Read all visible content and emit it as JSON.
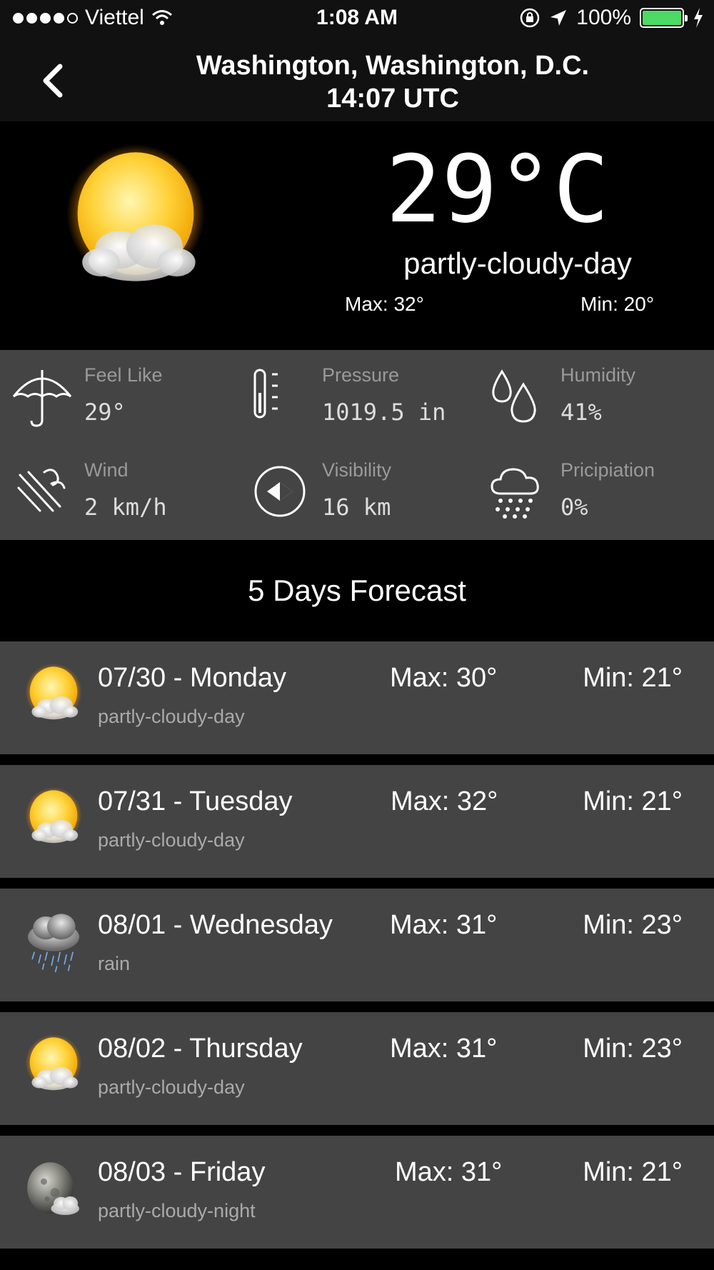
{
  "status_bar": {
    "carrier": "Viettel",
    "time": "1:08 AM",
    "battery": "100%",
    "battery_level": 1.0
  },
  "header": {
    "location": "Washington, Washington D.C.",
    "location_display": "Washington, Washington, D.C.",
    "time": "14:07 UTC"
  },
  "current": {
    "temperature": "29°C",
    "condition": "partly-cloudy-day",
    "max": "Max:  32°",
    "min": "Min:   20°",
    "icon": "partly-cloudy-day-icon"
  },
  "details": [
    {
      "label": "Feel Like",
      "value": "29°",
      "icon": "umbrella-icon"
    },
    {
      "label": "Pressure",
      "value": "1019.5 in",
      "icon": "thermometer-icon"
    },
    {
      "label": "Humidity",
      "value": "41%",
      "icon": "droplets-icon"
    },
    {
      "label": "Wind",
      "value": "2 km/h",
      "icon": "wind-icon"
    },
    {
      "label": "Visibility",
      "value": "16 km",
      "icon": "compass-icon"
    },
    {
      "label": "Pricipiation",
      "value": "0%",
      "icon": "cloud-rain-icon"
    }
  ],
  "forecast_title": "5 Days Forecast",
  "forecast": [
    {
      "date": "07/30 - Monday",
      "condition": "partly-cloudy-day",
      "max": "Max: 30°",
      "min": "Min: 21°",
      "icon": "partly-cloudy-day-icon"
    },
    {
      "date": "07/31 - Tuesday",
      "condition": "partly-cloudy-day",
      "max": "Max: 32°",
      "min": "Min: 21°",
      "icon": "partly-cloudy-day-icon"
    },
    {
      "date": "08/01 - Wednesday",
      "condition": "rain",
      "max": "Max: 31°",
      "min": "Min: 23°",
      "icon": "rain-icon"
    },
    {
      "date": "08/02 - Thursday",
      "condition": "partly-cloudy-day",
      "max": "Max: 31°",
      "min": "Min: 23°",
      "icon": "partly-cloudy-day-icon"
    },
    {
      "date": "08/03 - Friday",
      "condition": "partly-cloudy-night",
      "max": "Max: 31°",
      "min": "Min: 21°",
      "icon": "partly-cloudy-night-icon"
    }
  ],
  "colors": {
    "background": "#000000",
    "bar": "#111111",
    "panel": "#444444",
    "battery": "#4cd964"
  }
}
